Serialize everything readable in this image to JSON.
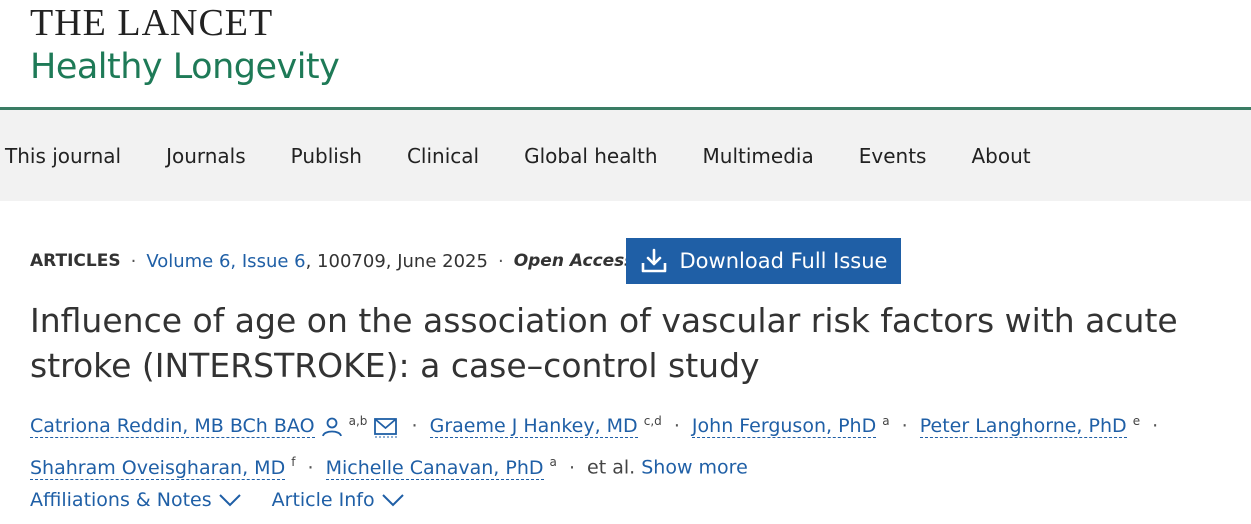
{
  "brand": {
    "top": "THE LANCET",
    "sub": "Healthy Longevity"
  },
  "nav": [
    "This journal",
    "Journals",
    "Publish",
    "Clinical",
    "Global health",
    "Multimedia",
    "Events",
    "About"
  ],
  "meta": {
    "type": "ARTICLES",
    "volume": "Volume 6, Issue 6",
    "number": ", 100709, June 2025",
    "access": "Open Access"
  },
  "download_label": "Download Full Issue",
  "title": "Influence of age on the association of vascular risk factors with acute stroke (INTERSTROKE): a case–control study",
  "authors": [
    {
      "name": "Catriona Reddin, MB BCh BAO",
      "sup": "a,b"
    },
    {
      "name": "Graeme J Hankey, MD",
      "sup": "c,d"
    },
    {
      "name": "John Ferguson, PhD",
      "sup": "a"
    },
    {
      "name": "Peter Langhorne, PhD",
      "sup": "e"
    },
    {
      "name": "Shahram Oveisgharan, MD",
      "sup": "f"
    },
    {
      "name": "Michelle Canavan, PhD",
      "sup": "a"
    }
  ],
  "etal": "et al.",
  "show_more": "Show more",
  "tabs": [
    "Affiliations & Notes",
    "Article Info"
  ],
  "colors": {
    "brand_green": "#1e7a57",
    "link_blue": "#1f5fa6",
    "button_blue": "#1f5fa6",
    "nav_bg": "#f2f2f2"
  },
  "icons": [
    "person-icon",
    "mail-icon",
    "download-icon",
    "chevron-down-icon"
  ]
}
